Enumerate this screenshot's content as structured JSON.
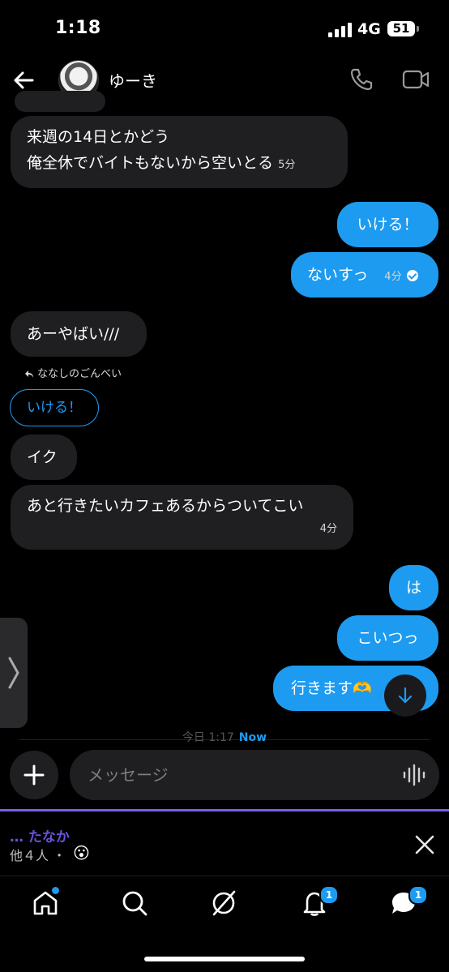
{
  "status": {
    "time": "1:18",
    "network": "4G",
    "battery": "51"
  },
  "header": {
    "contact_name": "ゆーき"
  },
  "messages": {
    "m1_line1": "来週の14日とかどう",
    "m1_line2": "俺全休でバイトもないから空いとる",
    "m1_time": "5分",
    "m2_text": "いける！",
    "m3_text": "ないすっ",
    "m3_time": "4分",
    "m4_text": "あーやばい///",
    "reply_to_name": "ななしのごんべい",
    "reply_quote": "いける！",
    "m5_text": "イク",
    "m6_text": "あと行きたいカフェあるからついてこい",
    "m6_time": "4分",
    "m7_text": "は",
    "m8_text": "こいつっ",
    "m9_text": "行きます🫶"
  },
  "divider": {
    "today": "今日 1:17",
    "now": "Now"
  },
  "composer": {
    "placeholder": "メッセージ"
  },
  "typing": {
    "name": "… たなか",
    "others": "他４人 ・",
    "emoji": "😮"
  },
  "tabbar": {
    "notifications_badge": "1",
    "messages_badge": "1"
  },
  "colors": {
    "accent": "#1d9bf0",
    "incoming_bubble": "#1f1f22",
    "typing_purple": "#7b5cf0"
  }
}
